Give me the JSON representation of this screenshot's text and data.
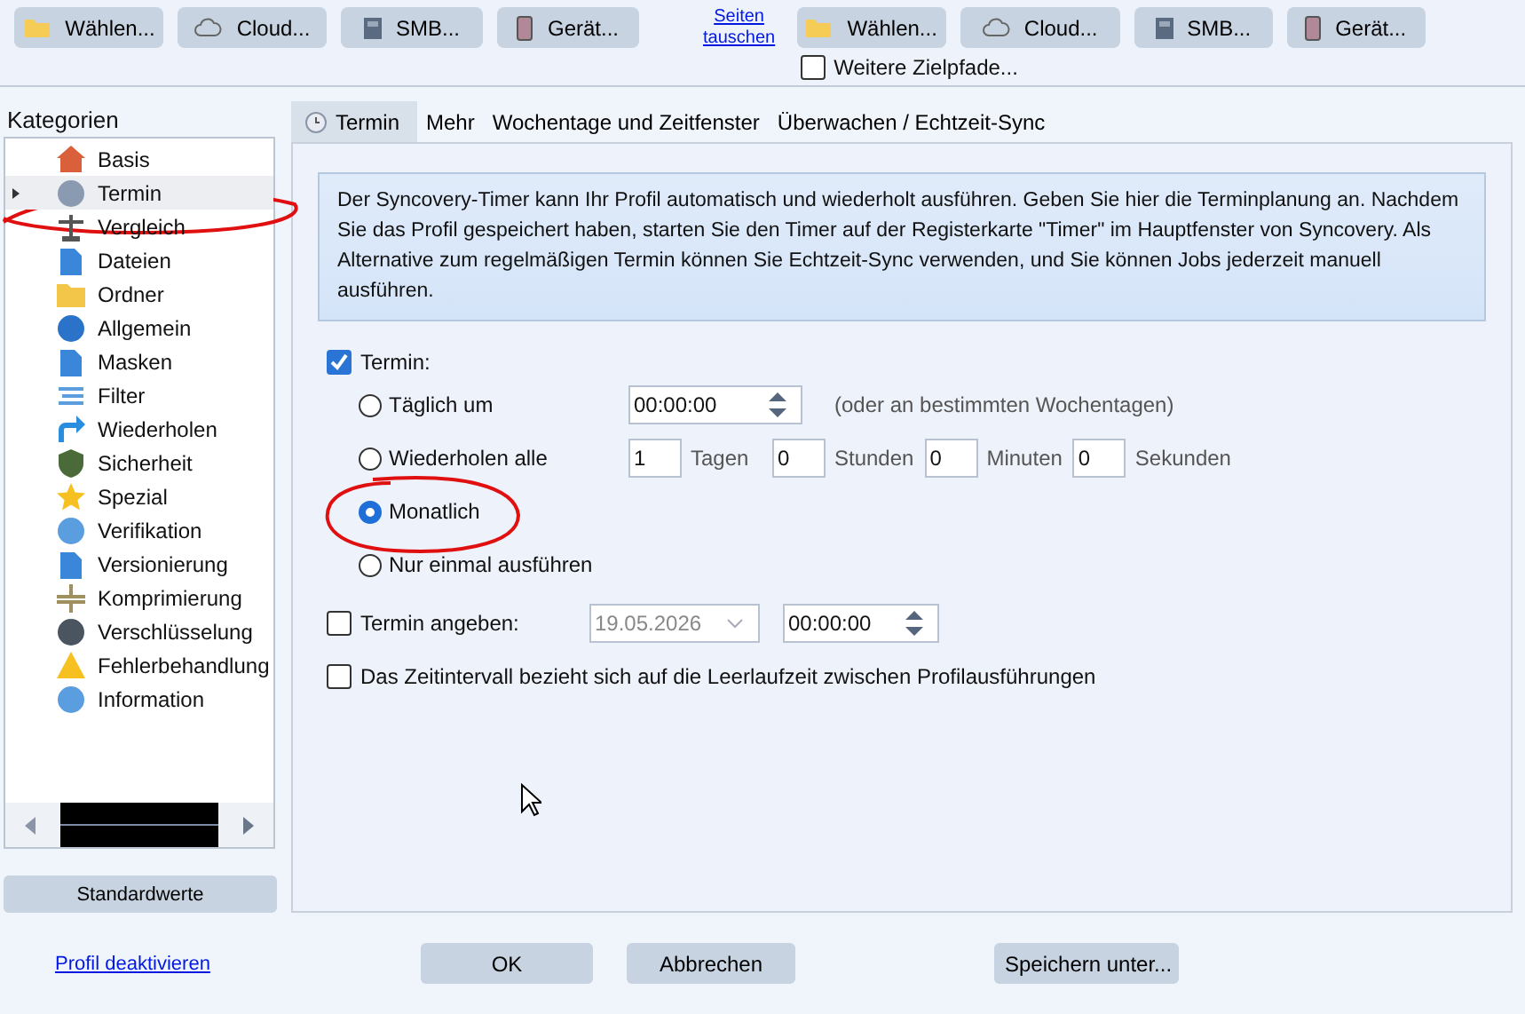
{
  "top_bar": {
    "source_buttons": [
      "Wählen...",
      "Cloud...",
      "SMB...",
      "Gerät..."
    ],
    "swap_link": [
      "Seiten",
      "tauschen"
    ],
    "target_buttons": [
      "Wählen...",
      "Cloud...",
      "SMB...",
      "Gerät..."
    ],
    "more_targets": {
      "label": "Weitere Zielpfade...",
      "checked": false
    }
  },
  "categories": {
    "title": "Kategorien",
    "items": [
      {
        "label": "Basis",
        "selected": false
      },
      {
        "label": "Termin",
        "selected": true
      },
      {
        "label": "Vergleich",
        "selected": false
      },
      {
        "label": "Dateien",
        "selected": false
      },
      {
        "label": "Ordner",
        "selected": false
      },
      {
        "label": "Allgemein",
        "selected": false
      },
      {
        "label": "Masken",
        "selected": false
      },
      {
        "label": "Filter",
        "selected": false
      },
      {
        "label": "Wiederholen",
        "selected": false
      },
      {
        "label": "Sicherheit",
        "selected": false
      },
      {
        "label": "Spezial",
        "selected": false
      },
      {
        "label": "Verifikation",
        "selected": false
      },
      {
        "label": "Versionierung",
        "selected": false
      },
      {
        "label": "Komprimierung",
        "selected": false
      },
      {
        "label": "Verschlüsselung",
        "selected": false
      },
      {
        "label": "Fehlerbehandlung",
        "selected": false
      },
      {
        "label": "Information",
        "selected": false
      }
    ]
  },
  "defaults_button": "Standardwerte",
  "tabs": [
    {
      "label": "Termin",
      "selected": true
    },
    {
      "label": "Mehr",
      "selected": false
    },
    {
      "label": "Wochentage und Zeitfenster",
      "selected": false
    },
    {
      "label": "Überwachen / Echtzeit-Sync",
      "selected": false
    }
  ],
  "info_text": "Der Syncovery-Timer kann Ihr Profil automatisch und wiederholt ausführen. Geben Sie hier die Terminplanung an. Nachdem Sie das Profil gespeichert haben, starten Sie den Timer auf der Registerkarte \"Timer\" im Hauptfenster von Syncovery. Als Alternative zum regelmäßigen Termin können Sie Echtzeit-Sync verwenden, und Sie können Jobs jederzeit manuell ausführen.",
  "schedule": {
    "label": "Termin:",
    "checked": true,
    "options": [
      {
        "kind": "time",
        "label": "Täglich um",
        "selected": false,
        "value": "00:00:00",
        "hint": "(oder an bestimmten Wochentagen)"
      },
      {
        "kind": "interval",
        "label": "Wiederholen alle",
        "selected": false,
        "fields": [
          {
            "value": "1",
            "unit": "Tagen"
          },
          {
            "value": "0",
            "unit": "Stunden"
          },
          {
            "value": "0",
            "unit": "Minuten"
          },
          {
            "value": "0",
            "unit": "Sekunden"
          }
        ]
      },
      {
        "kind": "plain",
        "label": "Monatlich",
        "selected": true
      },
      {
        "kind": "plain",
        "label": "Nur einmal ausführen",
        "selected": false
      }
    ]
  },
  "specific_date": {
    "label": "Termin angeben:",
    "checked": false,
    "date": "19.05.2026",
    "time": "00:00:00"
  },
  "idle_interval": {
    "label": "Das Zeitintervall bezieht sich auf die Leerlaufzeit zwischen Profilausführungen",
    "checked": false
  },
  "footer": {
    "link": "Profil deaktivieren",
    "buttons": [
      "OK",
      "Abbrechen",
      "Speichern unter..."
    ]
  }
}
